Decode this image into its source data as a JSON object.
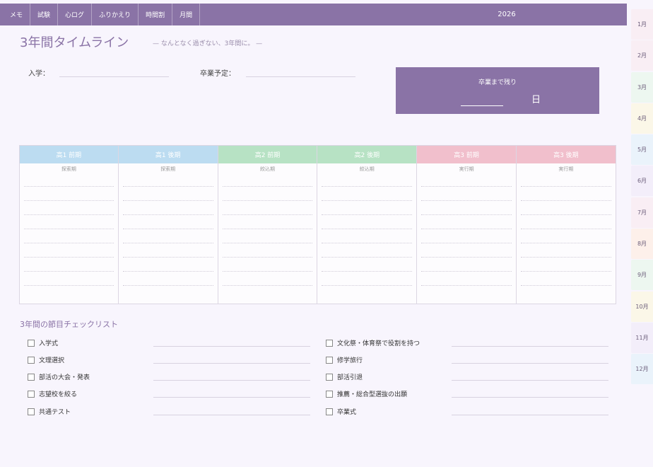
{
  "nav": {
    "items": [
      "メモ",
      "試験",
      "心ログ",
      "ふりかえり",
      "時間割",
      "月間"
    ],
    "year": "2026"
  },
  "months": [
    "1月",
    "2月",
    "3月",
    "4月",
    "5月",
    "6月",
    "7月",
    "8月",
    "9月",
    "10月",
    "11月",
    "12月"
  ],
  "month_colors": [
    "#f9eef4",
    "#f9eef4",
    "#edf7f0",
    "#fbf7e8",
    "#eaf3fb",
    "#f3eefa",
    "#f9eef4",
    "#fdf0ea",
    "#edf7f0",
    "#fbf7e8",
    "#f3eefa",
    "#eaf3fb"
  ],
  "header": {
    "title": "3年間タイムライン",
    "subtitle": "— なんとなく過ぎない、3年間に。 —"
  },
  "fields": {
    "admission_label": "入学：",
    "graduation_label": "卒業予定："
  },
  "countdown": {
    "label": "卒業まで残り",
    "unit": "日"
  },
  "timeline": [
    {
      "term": "高1 前期",
      "phase": "探索期",
      "color": "#bcdcf1"
    },
    {
      "term": "高1 後期",
      "phase": "探索期",
      "color": "#bcdcf1"
    },
    {
      "term": "高2 前期",
      "phase": "絞込期",
      "color": "#b7e2c4"
    },
    {
      "term": "高2 後期",
      "phase": "絞込期",
      "color": "#b7e2c4"
    },
    {
      "term": "高3 前期",
      "phase": "実行期",
      "color": "#f1bfcc"
    },
    {
      "term": "高3 後期",
      "phase": "実行期",
      "color": "#f1bfcc"
    }
  ],
  "checklist": {
    "title": "3年間の節目チェックリスト",
    "left": [
      "入学式",
      "文理選択",
      "部活の大会・発表",
      "志望校を絞る",
      "共通テスト"
    ],
    "right": [
      "文化祭・体育祭で役割を持つ",
      "修学旅行",
      "部活引退",
      "推薦・総合型選抜の出願",
      "卒業式"
    ]
  },
  "colors": {
    "accent": "#8a73a6",
    "background": "#f8f5fd"
  }
}
